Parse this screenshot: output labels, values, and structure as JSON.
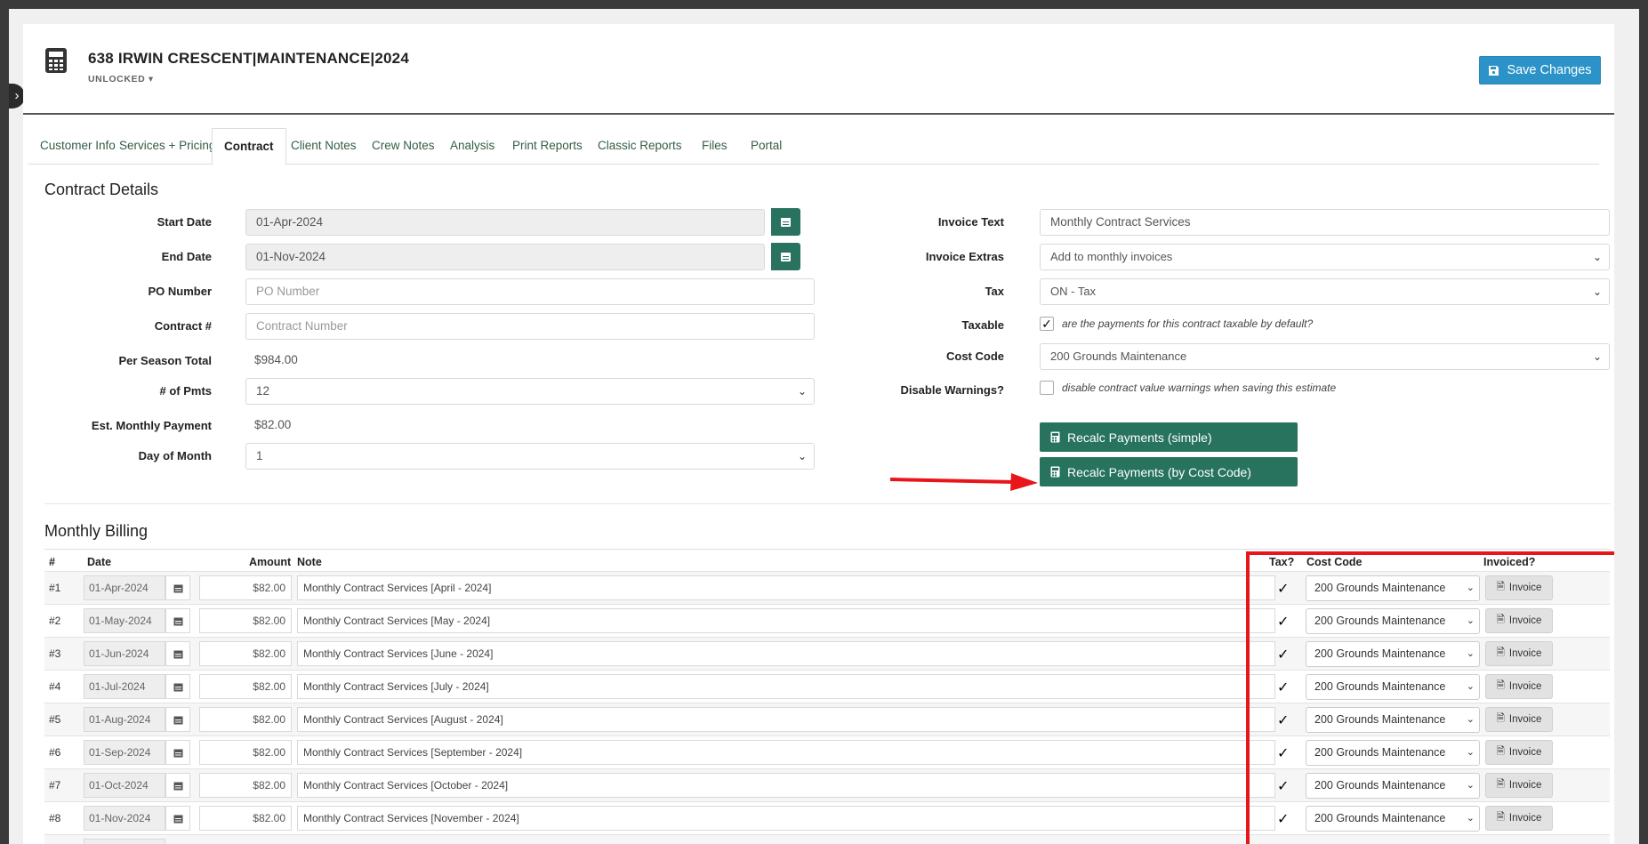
{
  "header": {
    "title": "638 IRWIN CRESCENT|MAINTENANCE|2024",
    "lock_status": "UNLOCKED",
    "save_label": "Save Changes"
  },
  "tabs": [
    {
      "label": "Customer Info"
    },
    {
      "label": "Services + Pricing"
    },
    {
      "label": "Contract",
      "active": true
    },
    {
      "label": "Client Notes"
    },
    {
      "label": "Crew Notes"
    },
    {
      "label": "Analysis"
    },
    {
      "label": "Print Reports"
    },
    {
      "label": "Classic Reports"
    },
    {
      "label": "Files"
    },
    {
      "label": "Portal"
    }
  ],
  "contract": {
    "section_title": "Contract Details",
    "start_date": {
      "label": "Start Date",
      "value": "01-Apr-2024"
    },
    "end_date": {
      "label": "End Date",
      "value": "01-Nov-2024"
    },
    "po_number": {
      "label": "PO Number",
      "placeholder": "PO Number",
      "value": ""
    },
    "contract_num": {
      "label": "Contract #",
      "placeholder": "Contract Number",
      "value": ""
    },
    "per_season_total": {
      "label": "Per Season Total",
      "value": "$984.00"
    },
    "num_pmts": {
      "label": "# of Pmts",
      "value": "12"
    },
    "est_monthly": {
      "label": "Est. Monthly Payment",
      "value": "$82.00"
    },
    "day_of_month": {
      "label": "Day of Month",
      "value": "1"
    },
    "invoice_text": {
      "label": "Invoice Text",
      "value": "Monthly Contract Services"
    },
    "invoice_extras": {
      "label": "Invoice Extras",
      "value": "Add to monthly invoices"
    },
    "tax": {
      "label": "Tax",
      "value": "ON - Tax"
    },
    "taxable": {
      "label": "Taxable",
      "checked": true,
      "note": "are the payments for this contract taxable by default?"
    },
    "cost_code": {
      "label": "Cost Code",
      "value": "200 Grounds Maintenance"
    },
    "disable_warnings": {
      "label": "Disable Warnings?",
      "checked": false,
      "note": "disable contract value warnings when saving this estimate"
    },
    "recalc_simple_label": "Recalc Payments (simple)",
    "recalc_costcode_label": "Recalc Payments (by Cost Code)"
  },
  "billing": {
    "section_title": "Monthly Billing",
    "columns": {
      "num": "#",
      "date": "Date",
      "amount": "Amount",
      "note": "Note",
      "tax": "Tax?",
      "cost_code": "Cost Code",
      "invoiced": "Invoiced?"
    },
    "invoice_button_label": "Invoice",
    "rows": [
      {
        "num": "#1",
        "date": "01-Apr-2024",
        "amount": "$82.00",
        "note": "Monthly Contract Services [April - 2024]",
        "tax": true,
        "cost_code": "200 Grounds Maintenance"
      },
      {
        "num": "#2",
        "date": "01-May-2024",
        "amount": "$82.00",
        "note": "Monthly Contract Services [May - 2024]",
        "tax": true,
        "cost_code": "200 Grounds Maintenance"
      },
      {
        "num": "#3",
        "date": "01-Jun-2024",
        "amount": "$82.00",
        "note": "Monthly Contract Services [June - 2024]",
        "tax": true,
        "cost_code": "200 Grounds Maintenance"
      },
      {
        "num": "#4",
        "date": "01-Jul-2024",
        "amount": "$82.00",
        "note": "Monthly Contract Services [July - 2024]",
        "tax": true,
        "cost_code": "200 Grounds Maintenance"
      },
      {
        "num": "#5",
        "date": "01-Aug-2024",
        "amount": "$82.00",
        "note": "Monthly Contract Services [August - 2024]",
        "tax": true,
        "cost_code": "200 Grounds Maintenance"
      },
      {
        "num": "#6",
        "date": "01-Sep-2024",
        "amount": "$82.00",
        "note": "Monthly Contract Services [September - 2024]",
        "tax": true,
        "cost_code": "200 Grounds Maintenance"
      },
      {
        "num": "#7",
        "date": "01-Oct-2024",
        "amount": "$82.00",
        "note": "Monthly Contract Services [October - 2024]",
        "tax": true,
        "cost_code": "200 Grounds Maintenance"
      },
      {
        "num": "#8",
        "date": "01-Nov-2024",
        "amount": "$82.00",
        "note": "Monthly Contract Services [November - 2024]",
        "tax": true,
        "cost_code": "200 Grounds Maintenance"
      }
    ]
  },
  "colors": {
    "accent_green": "#27735d",
    "save_blue": "#2b93c7",
    "annotation_red": "#e8161b"
  },
  "icons": [
    "calculator-icon",
    "floppy-disk-icon",
    "calendar-icon",
    "caret-down-icon",
    "checkmark-icon",
    "document-icon",
    "arrow-annotation"
  ]
}
